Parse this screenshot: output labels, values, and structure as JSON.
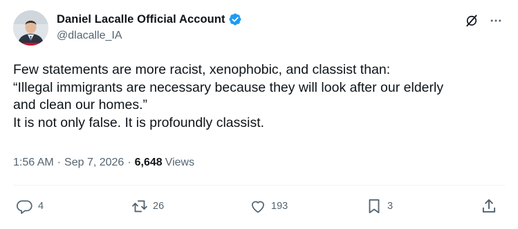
{
  "author": {
    "display_name": "Daniel Lacalle Official Account",
    "handle": "@dlacalle_IA",
    "avatar_icon": "avatar-photo",
    "verified_icon": "verified-badge-icon",
    "verified_color": "#1d9bf0"
  },
  "top_actions": {
    "grok_icon": "grok-icon",
    "more_icon": "more-dots-icon"
  },
  "tweet": {
    "lines": [
      "Few statements are more racist, xenophobic, and classist than:",
      "“Illegal immigrants are necessary because they will look after our elderly",
      "and clean our homes.”",
      "It is not only false. It is profoundly classist."
    ]
  },
  "meta": {
    "time": "1:56 AM",
    "separator": "·",
    "date": "Sep 7, 2026",
    "views_count": "6,648",
    "views_label": "Views"
  },
  "actions": {
    "replies": {
      "icon": "reply-icon",
      "count": "4"
    },
    "reposts": {
      "icon": "repost-icon",
      "count": "26"
    },
    "likes": {
      "icon": "like-icon",
      "count": "193"
    },
    "bookmarks": {
      "icon": "bookmark-icon",
      "count": "3"
    },
    "share": {
      "icon": "share-icon"
    }
  },
  "colors": {
    "text": "#0f1419",
    "secondary": "#536471",
    "accent": "#1d9bf0",
    "divider": "#eff3f4"
  }
}
